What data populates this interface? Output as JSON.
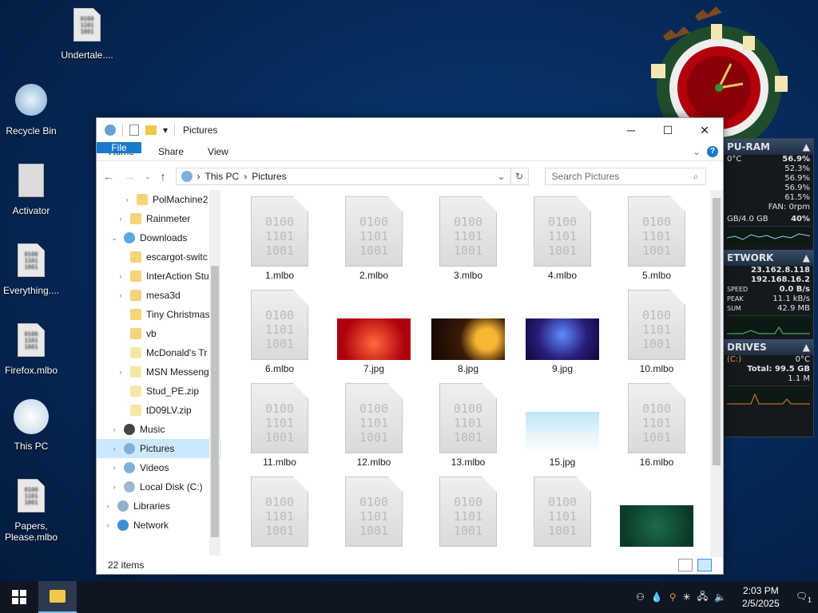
{
  "desktop": {
    "icons": [
      {
        "label": "Undertale....",
        "icon": "binary-file-icon"
      },
      {
        "label": "Recycle Bin",
        "icon": "recycle-bin-icon"
      },
      {
        "label": "Activator",
        "icon": "activator-icon"
      },
      {
        "label": "Everything....",
        "icon": "binary-file-icon"
      },
      {
        "label": "Firefox.mlbo",
        "icon": "binary-file-icon"
      },
      {
        "label": "This PC",
        "icon": "this-pc-icon"
      },
      {
        "label": "Papers, Please.mlbo",
        "icon": "binary-file-icon"
      }
    ]
  },
  "rainmeter": {
    "cpu_header": "PU-RAM",
    "temp": "0°C",
    "cpu_total": "56.9%",
    "cores": [
      "52.3%",
      "56.9%",
      "56.9%",
      "61.5%"
    ],
    "fan": "FAN: 0rpm",
    "ram": "GB/4.0 GB",
    "ram_pct": "40%",
    "net_header": "ETWORK",
    "ip1": "23.162.8.118",
    "ip2": "192.168.16.2",
    "speed_label": "SPEED",
    "speed": "0.0 B/s",
    "peak_label": "PEAK",
    "peak": "11.1 kB/s",
    "sum_label": "SUM",
    "sum": "42.9 MB",
    "drives_header": "DRIVES",
    "drive": "(C:)",
    "drive_temp": "0°C",
    "drive_total": "Total: 99.5 GB",
    "drive_io": "1.1 M"
  },
  "window": {
    "title": "Pictures",
    "ribbon": {
      "file": "File",
      "tabs": [
        "Home",
        "Share",
        "View"
      ]
    },
    "address": {
      "segments": [
        "This PC",
        "Pictures"
      ]
    },
    "search_placeholder": "Search Pictures",
    "nav": [
      {
        "label": "PolMachine2",
        "indent": 2,
        "arrow": "›",
        "icon": "folder"
      },
      {
        "label": "Rainmeter",
        "indent": 1,
        "arrow": "›",
        "icon": "folder"
      },
      {
        "label": "Downloads",
        "indent": 0,
        "arrow": "⌄",
        "icon": "downloads"
      },
      {
        "label": "escargot-switc",
        "indent": 1,
        "arrow": "",
        "icon": "folder"
      },
      {
        "label": "InterAction Stu",
        "indent": 1,
        "arrow": "›",
        "icon": "folder"
      },
      {
        "label": "mesa3d",
        "indent": 1,
        "arrow": "›",
        "icon": "folder"
      },
      {
        "label": "Tiny Christmas",
        "indent": 1,
        "arrow": "",
        "icon": "folder"
      },
      {
        "label": "vb",
        "indent": 1,
        "arrow": "",
        "icon": "folder"
      },
      {
        "label": "McDonald's Tr",
        "indent": 1,
        "arrow": "",
        "icon": "zip"
      },
      {
        "label": "MSN Messeng",
        "indent": 1,
        "arrow": "›",
        "icon": "zip"
      },
      {
        "label": "Stud_PE.zip",
        "indent": 1,
        "arrow": "",
        "icon": "zip"
      },
      {
        "label": "tD09LV.zip",
        "indent": 1,
        "arrow": "",
        "icon": "zip"
      },
      {
        "label": "Music",
        "indent": 0,
        "arrow": "›",
        "icon": "music"
      },
      {
        "label": "Pictures",
        "indent": 0,
        "arrow": "›",
        "icon": "pictures",
        "selected": true
      },
      {
        "label": "Videos",
        "indent": 0,
        "arrow": "›",
        "icon": "videos"
      },
      {
        "label": "Local Disk (C:)",
        "indent": 0,
        "arrow": "›",
        "icon": "disk"
      },
      {
        "label": "Libraries",
        "indent": -1,
        "arrow": "›",
        "icon": "library"
      },
      {
        "label": "Network",
        "indent": -1,
        "arrow": "›",
        "icon": "network"
      }
    ],
    "files": [
      {
        "name": "1.mlbo",
        "type": "bin"
      },
      {
        "name": "2.mlbo",
        "type": "bin"
      },
      {
        "name": "3.mlbo",
        "type": "bin"
      },
      {
        "name": "4.mlbo",
        "type": "bin"
      },
      {
        "name": "5.mlbo",
        "type": "bin"
      },
      {
        "name": "6.mlbo",
        "type": "bin"
      },
      {
        "name": "7.jpg",
        "type": "img",
        "color": "red"
      },
      {
        "name": "8.jpg",
        "type": "img",
        "color": "tree"
      },
      {
        "name": "9.jpg",
        "type": "img",
        "color": "blue"
      },
      {
        "name": "10.mlbo",
        "type": "bin"
      },
      {
        "name": "11.mlbo",
        "type": "bin"
      },
      {
        "name": "12.mlbo",
        "type": "bin"
      },
      {
        "name": "13.mlbo",
        "type": "bin"
      },
      {
        "name": "15.jpg",
        "type": "img",
        "color": "santa"
      },
      {
        "name": "16.mlbo",
        "type": "bin"
      },
      {
        "name": "",
        "type": "bin"
      },
      {
        "name": "",
        "type": "bin"
      },
      {
        "name": "",
        "type": "bin"
      },
      {
        "name": "",
        "type": "bin"
      },
      {
        "name": "",
        "type": "img",
        "color": "green"
      }
    ],
    "status": "22 items"
  },
  "taskbar": {
    "time": "2:03 PM",
    "date": "2/5/2025",
    "notifications": "1"
  },
  "colors": {
    "accent": "#1979ca",
    "selection": "#cce8ff",
    "taskbar": "#0f1621"
  }
}
